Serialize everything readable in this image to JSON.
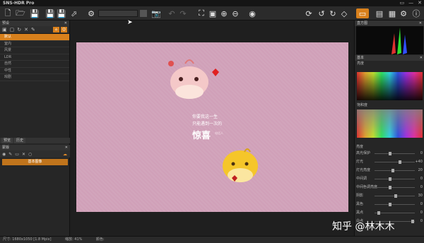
{
  "app": {
    "title": "SNS-HDR Pro"
  },
  "window_buttons": [
    "▭",
    "—",
    "✕"
  ],
  "toolbar": {
    "zoom_value": "",
    "icons": [
      "new-file-icon",
      "open-file-icon",
      "save-icon",
      "save-as-icon",
      "export-icon",
      "settings-gear-icon",
      "camera-icon",
      "fit-icon",
      "zoom-in-icon",
      "zoom-out-icon",
      "preview-eye-icon",
      "rotate-icon",
      "undo-icon",
      "flip-icon",
      "monitor-icon",
      "layout-icon",
      "grid-icon",
      "settings-icon",
      "info-icon"
    ]
  },
  "left_panel": {
    "presets_header": "预设",
    "presets": [
      {
        "label": "默认",
        "selected": true
      },
      {
        "label": "室内",
        "selected": false
      },
      {
        "label": "风景",
        "selected": false
      },
      {
        "label": "LDR",
        "selected": false
      },
      {
        "label": "自然",
        "selected": false
      },
      {
        "label": "中性",
        "selected": false
      },
      {
        "label": "戏剧",
        "selected": false
      }
    ],
    "tabs": [
      "预览",
      "历史"
    ],
    "overlay_header": "蒙版",
    "overlay_button": "基本图像"
  },
  "canvas": {
    "text_line1": "你要我这一生",
    "text_line2": "只能遇到一次的",
    "text_big": "惊喜",
    "text_small": "电话人"
  },
  "right_panel": {
    "histogram_header": "直方图",
    "basic_header": "基本",
    "brightness_label": "亮度",
    "saturation_label": "饱和度",
    "sliders": [
      {
        "label": "亮度",
        "value": ""
      },
      {
        "label": "高光保护",
        "value": "0"
      },
      {
        "label": "灯光",
        "value": "+40"
      },
      {
        "label": "灯光亮度",
        "value": "20"
      },
      {
        "label": "中间调",
        "value": "0"
      },
      {
        "label": "中间色调亮度",
        "value": "0"
      },
      {
        "label": "阴影",
        "value": "30"
      },
      {
        "label": "黑色",
        "value": "0"
      },
      {
        "label": "黑点",
        "value": "0"
      },
      {
        "label": "白点",
        "value": "0"
      }
    ]
  },
  "statusbar": {
    "size": "尺寸: 1680x1050 [1.8 Mpix]",
    "zoom": "缩放: 41%",
    "color": "颜色:"
  },
  "watermark": "知乎 @林木木"
}
